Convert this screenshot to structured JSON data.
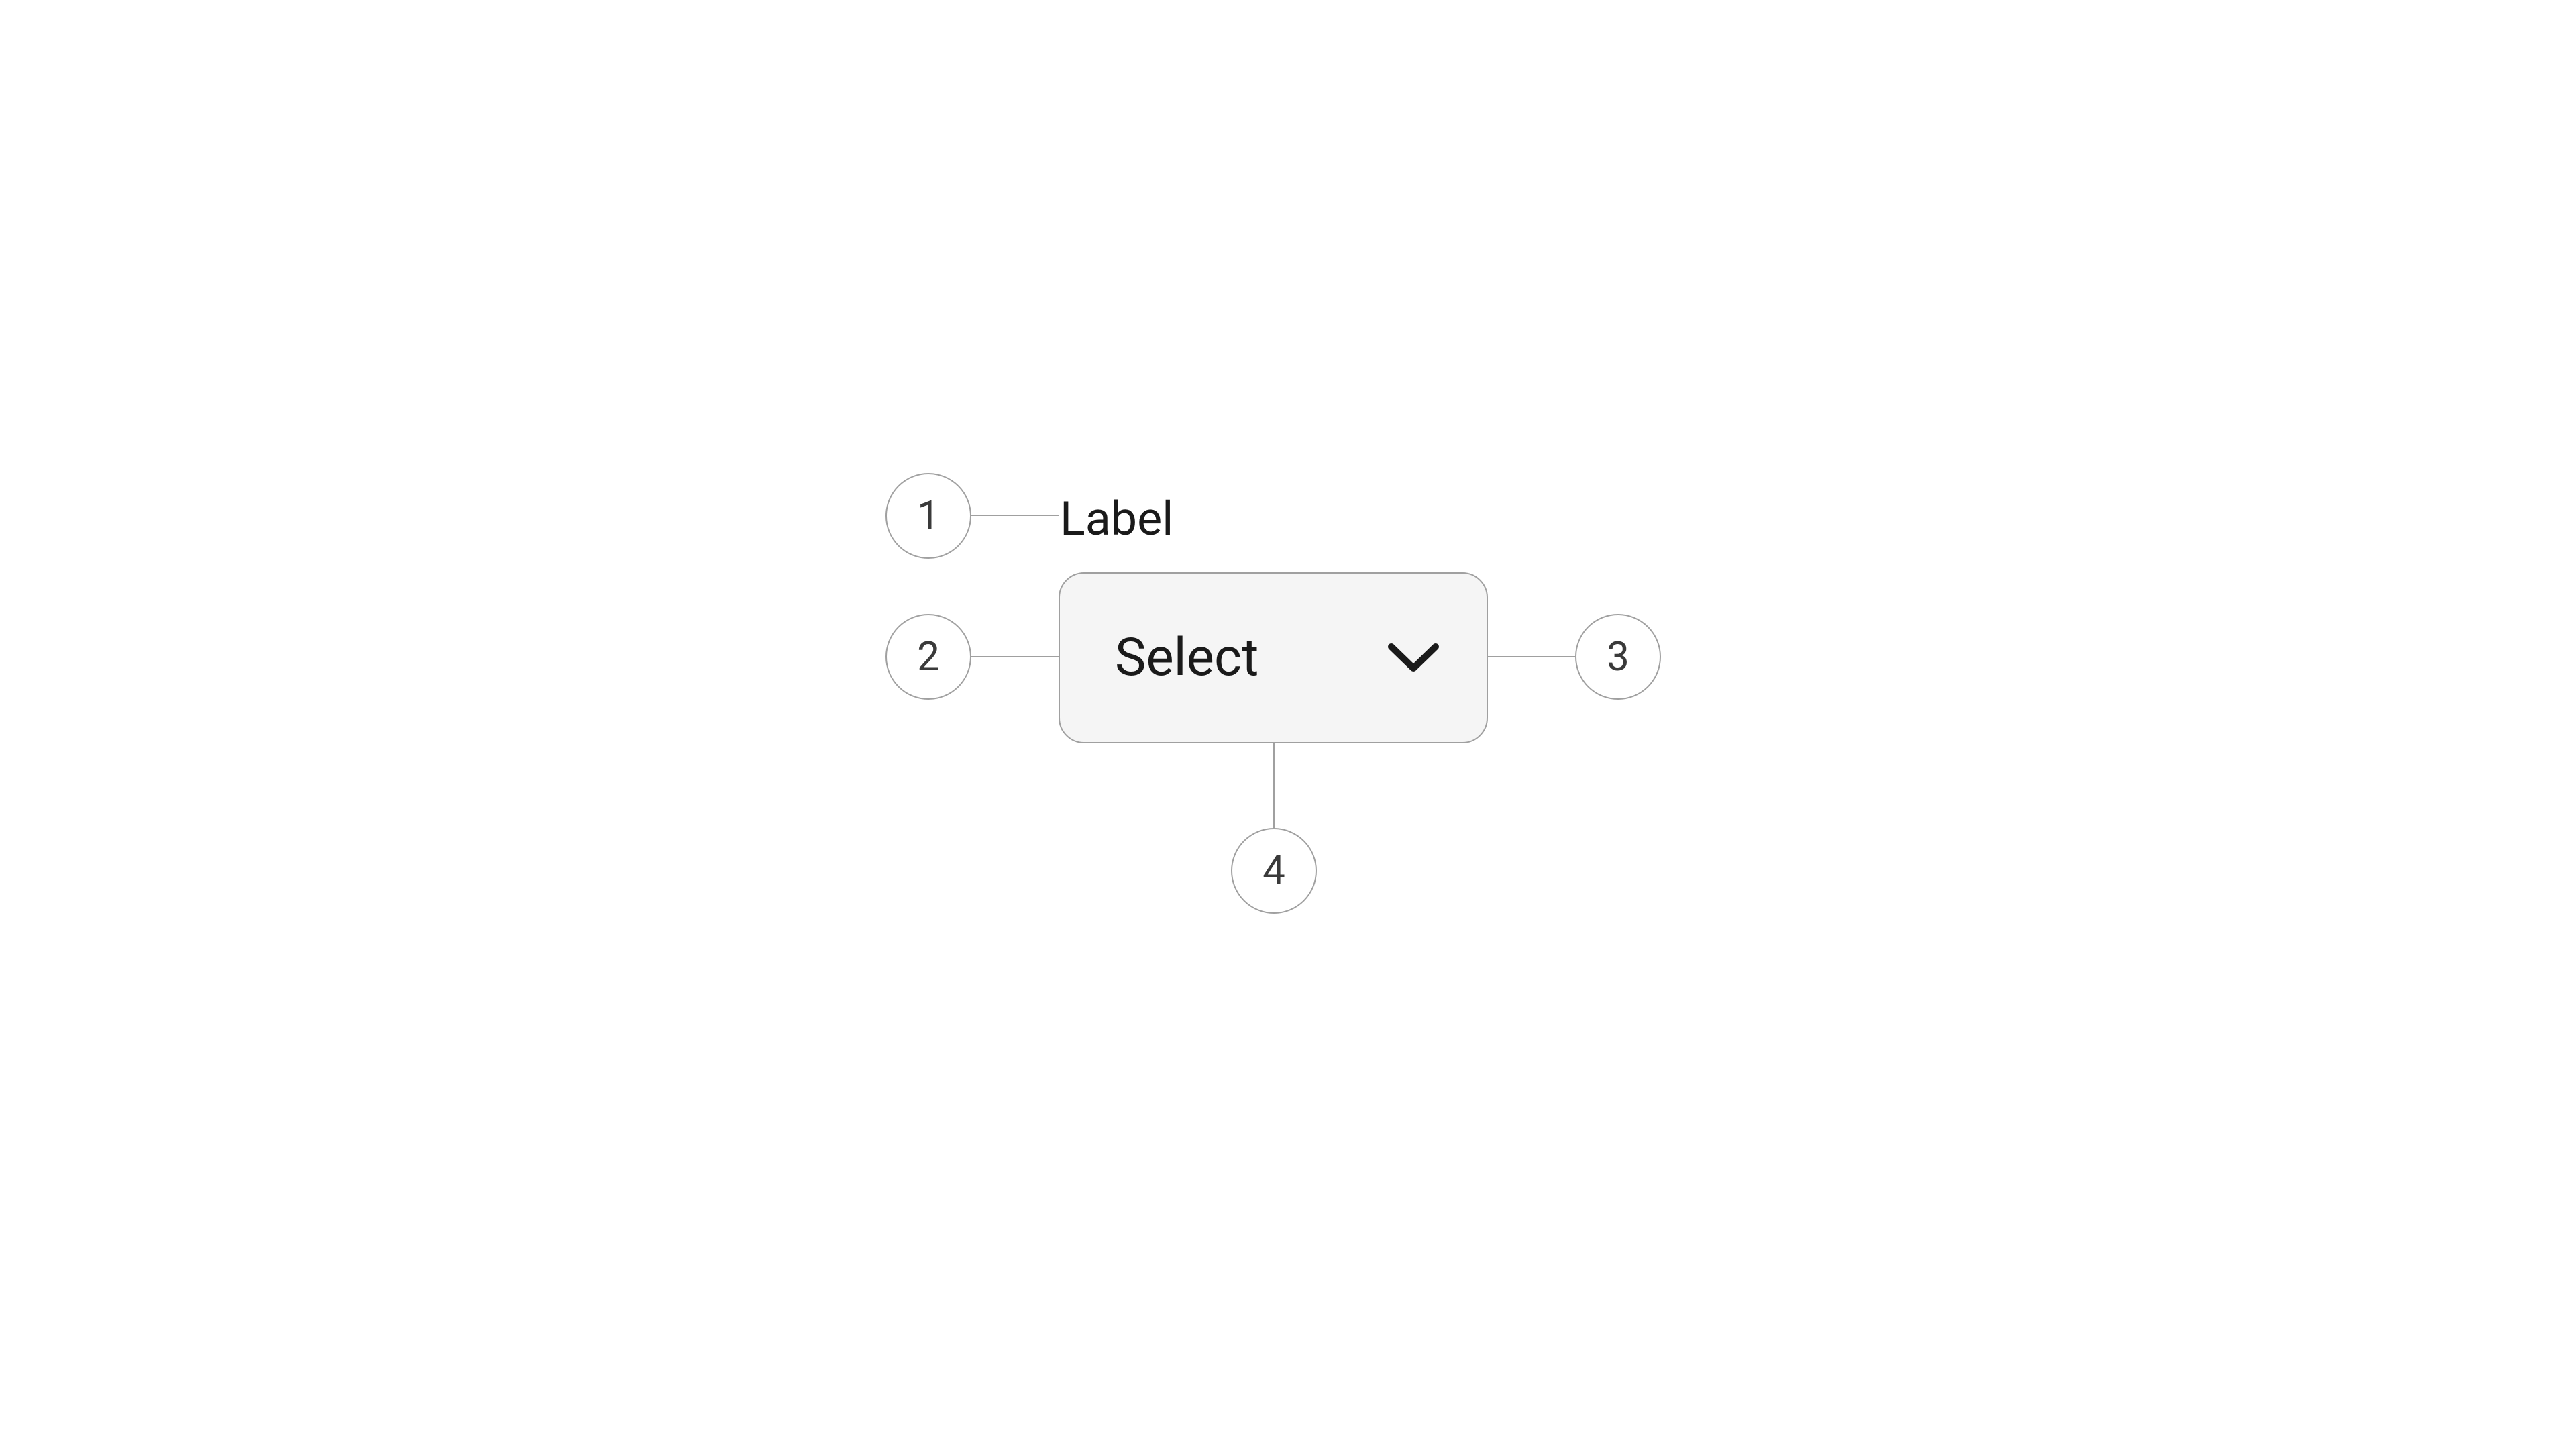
{
  "diagram": {
    "label_text": "Label",
    "select_placeholder": "Select",
    "markers": {
      "one": "1",
      "two": "2",
      "three": "3",
      "four": "4"
    }
  }
}
